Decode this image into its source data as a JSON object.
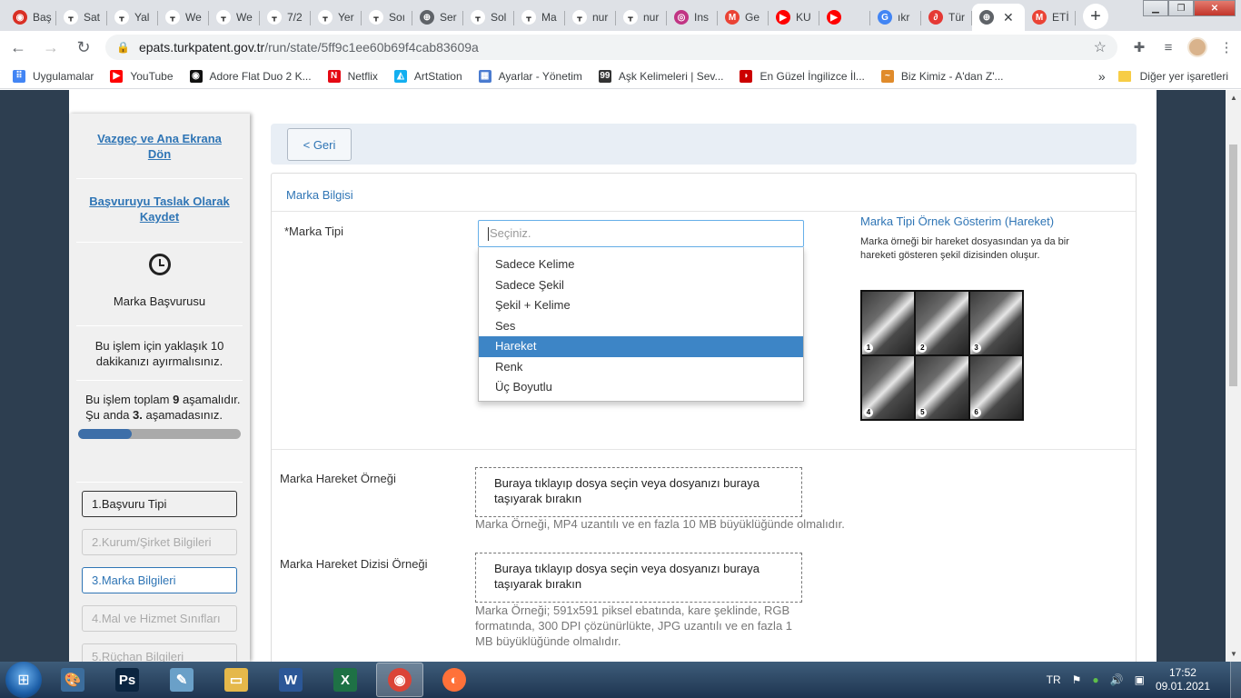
{
  "browser": {
    "tabs": [
      {
        "label": "Baş",
        "color": "#d93025",
        "glyph": "◉"
      },
      {
        "label": "Sat",
        "color": "#ffffff",
        "glyph": "ᚁ"
      },
      {
        "label": "Yal",
        "color": "#ffffff",
        "glyph": "ᚁ"
      },
      {
        "label": "We",
        "color": "#ffffff",
        "glyph": "ᚁ"
      },
      {
        "label": "We",
        "color": "#ffffff",
        "glyph": "ᚁ"
      },
      {
        "label": "7/2",
        "color": "#ffffff",
        "glyph": "ᚁ"
      },
      {
        "label": "Yer",
        "color": "#ffffff",
        "glyph": "ᚁ"
      },
      {
        "label": "Soı",
        "color": "#ffffff",
        "glyph": "ᚁ"
      },
      {
        "label": "Ser",
        "color": "#5f6368",
        "glyph": "⊕"
      },
      {
        "label": "Sol",
        "color": "#ffffff",
        "glyph": "ᚁ"
      },
      {
        "label": "Ma",
        "color": "#ffffff",
        "glyph": "ᚁ"
      },
      {
        "label": "nur",
        "color": "#ffffff",
        "glyph": "ᚁ"
      },
      {
        "label": "nur",
        "color": "#ffffff",
        "glyph": "ᚁ"
      },
      {
        "label": "Ins",
        "color": "#c13584",
        "glyph": "◎"
      },
      {
        "label": "Ge",
        "color": "#ea4335",
        "glyph": "M"
      },
      {
        "label": "KU",
        "color": "#ff0000",
        "glyph": "▶"
      },
      {
        "label": "",
        "color": "#ff0000",
        "glyph": "▶"
      },
      {
        "label": "ıkr",
        "color": "#4285f4",
        "glyph": "G"
      },
      {
        "label": "Tür",
        "color": "#e53935",
        "glyph": "∂"
      },
      {
        "label": "",
        "color": "#5f6368",
        "glyph": "⊕"
      },
      {
        "label": "ETİ",
        "color": "#ea4335",
        "glyph": "M"
      }
    ],
    "active_tab_index": 19,
    "url_host": "epats.turkpatent.gov.tr",
    "url_path": "/run/state/5ff9c1ee60b69f4cab83609a",
    "bookmarks": [
      {
        "label": "Uygulamalar",
        "icon": "apps-grid-icon",
        "color": "#4285f4",
        "glyph": "⠿"
      },
      {
        "label": "YouTube",
        "icon": "youtube-icon",
        "color": "#ff0000",
        "glyph": "▶"
      },
      {
        "label": "Adore Flat Duo 2 K...",
        "icon": "adore-icon",
        "color": "#111111",
        "glyph": "◉"
      },
      {
        "label": "Netflix",
        "icon": "netflix-icon",
        "color": "#e50914",
        "glyph": "N"
      },
      {
        "label": "ArtStation",
        "icon": "artstation-icon",
        "color": "#13aff0",
        "glyph": "◭"
      },
      {
        "label": "Ayarlar - Yönetim",
        "icon": "building-icon",
        "color": "#4a7bd0",
        "glyph": "▦"
      },
      {
        "label": "Aşk Kelimeleri | Sev...",
        "icon": "quote-icon",
        "color": "#333333",
        "glyph": "99"
      },
      {
        "label": "En Güzel İngilizce İl...",
        "icon": "lips-icon",
        "color": "#cc0000",
        "glyph": "◗"
      },
      {
        "label": "Biz Kimiz - A'dan Z'...",
        "icon": "site-icon",
        "color": "#e08b2b",
        "glyph": "~"
      }
    ],
    "other_bookmarks": "Diğer yer işaretleri"
  },
  "sidebar": {
    "cancel_link": "Vazgeç ve Ana Ekrana Dön",
    "save_draft_link": "Başvuruyu Taslak Olarak Kaydet",
    "application_title": "Marka Başvurusu",
    "time_note": "Bu işlem için yaklaşık 10 dakikanızı ayırmalısınız.",
    "stage_note_pre": "Bu işlem toplam ",
    "stage_total": "9",
    "stage_note_mid": " aşamalıdır. Şu anda ",
    "stage_current": "3.",
    "stage_note_post": " aşamadasınız.",
    "progress_fraction": 0.33,
    "steps": [
      {
        "label": "1.Başvuru Tipi",
        "state": "done"
      },
      {
        "label": "2.Kurum/Şirket Bilgileri",
        "state": "pending"
      },
      {
        "label": "3.Marka Bilgileri",
        "state": "current"
      },
      {
        "label": "4.Mal ve Hizmet Sınıfları",
        "state": "pending"
      },
      {
        "label": "5.Rüçhan Bilgileri",
        "state": "pending"
      }
    ]
  },
  "main": {
    "back_button": "< Geri",
    "panel_title": "Marka Bilgisi",
    "mark_type_label": "*Marka Tipi",
    "select_placeholder": "Seçiniz.",
    "options": [
      "Sadece Kelime",
      "Sadece Şekil",
      "Şekil + Kelime",
      "Ses",
      "Hareket",
      "Renk",
      "Üç Boyutlu"
    ],
    "selected_option_index": 4,
    "sample_title": "Marka Tipi Örnek Gösterim (Hareket)",
    "sample_desc": "Marka örneği bir hareket dosyasından ya da bir hareketi gösteren şekil dizisinden oluşur.",
    "frame_numbers": [
      "1",
      "2",
      "3",
      "4",
      "5",
      "6"
    ],
    "motion_label": "Marka Hareket Örneği",
    "motion_drop": "Buraya tıklayıp dosya seçin veya dosyanızı buraya taşıyarak bırakın",
    "motion_help": "Marka Örneği, MP4 uzantılı ve en fazla 10 MB büyüklüğünde olmalıdır.",
    "sequence_label": "Marka Hareket Dizisi Örneği",
    "sequence_drop": "Buraya tıklayıp dosya seçin veya dosyanızı buraya taşıyarak bırakın",
    "sequence_help": "Marka Örneği; 591x591 piksel ebatında, kare şeklinde, RGB formatında, 300 DPI çözünürlükte, JPG uzantılı ve en fazla 1 MB büyüklüğünde olmalıdır."
  },
  "taskbar": {
    "apps": [
      {
        "name": "paint-icon",
        "glyph": "🎨",
        "color": "#3c6d9c"
      },
      {
        "name": "photoshop-icon",
        "glyph": "Ps",
        "color": "#0b2540"
      },
      {
        "name": "notepad-icon",
        "glyph": "✎",
        "color": "#6aa0c8"
      },
      {
        "name": "explorer-icon",
        "glyph": "▭",
        "color": "#e5b84a"
      },
      {
        "name": "word-icon",
        "glyph": "W",
        "color": "#2b5797"
      },
      {
        "name": "excel-icon",
        "glyph": "X",
        "color": "#1e7145"
      },
      {
        "name": "chrome-icon",
        "glyph": "◉",
        "color": "#db4437"
      },
      {
        "name": "firefox-icon",
        "glyph": "◐",
        "color": "#ff7139"
      }
    ],
    "active_app_index": 6,
    "language": "TR",
    "time": "17:52",
    "date": "09.01.2021"
  }
}
